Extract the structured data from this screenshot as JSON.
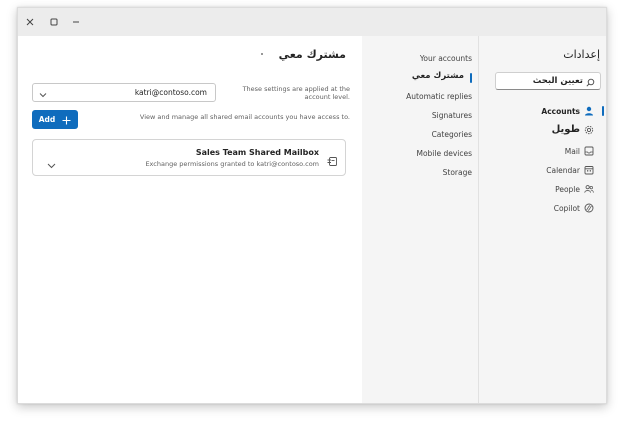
{
  "window": {
    "controls": {
      "close_icon": "close-icon",
      "maximize_icon": "maximize-icon",
      "minimize_icon": "minimize-icon"
    }
  },
  "settings": {
    "title": "إعدادات",
    "search": {
      "value": "تعيين البحث",
      "icon": "search-icon"
    },
    "categories": [
      {
        "label": "Accounts",
        "icon": "person-icon",
        "active": true
      },
      {
        "label": "طويل",
        "icon": "gear-icon"
      },
      {
        "label": "Mail",
        "icon": "mail-icon"
      },
      {
        "label": "Calendar",
        "icon": "calendar-icon"
      },
      {
        "label": "People",
        "icon": "people-icon"
      },
      {
        "label": "Copilot",
        "icon": "copilot-icon"
      }
    ]
  },
  "accounts_nav": {
    "items": [
      {
        "label": "Your accounts"
      },
      {
        "label": "مشترك معي",
        "active": true
      },
      {
        "label": "Automatic replies"
      },
      {
        "label": "Signatures"
      },
      {
        "label": "Categories"
      },
      {
        "label": "Mobile devices"
      },
      {
        "label": "Storage"
      }
    ]
  },
  "main": {
    "title": "مشترك معي",
    "account_select": {
      "value": "katri@contoso.com"
    },
    "help_text": "These settings are applied at the account level.",
    "help_text_2": "View and manage all shared email accounts you have access to.",
    "add_button": {
      "label": "Add"
    },
    "mailbox": {
      "title": "Sales Team Shared Mailbox",
      "subtitle": "Exchange permissions granted to katri@contoso.com"
    }
  },
  "colors": {
    "accent": "#0f6cbd",
    "titlebar": "#ececec",
    "panel": "#f5f5f5"
  }
}
